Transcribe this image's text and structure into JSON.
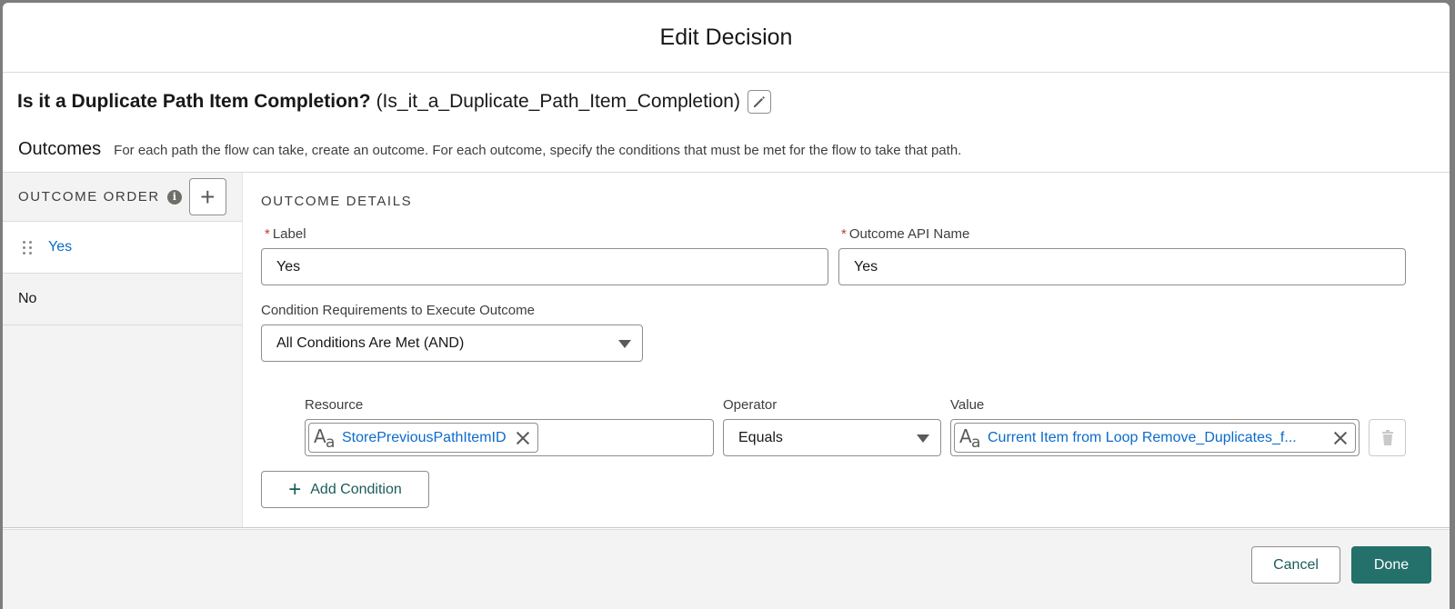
{
  "modal": {
    "title": "Edit Decision"
  },
  "decision": {
    "label": "Is it a Duplicate Path Item Completion?",
    "api_name": "(Is_it_a_Duplicate_Path_Item_Completion)"
  },
  "outcomes": {
    "title": "Outcomes",
    "description": "For each path the flow can take, create an outcome. For each outcome, specify the conditions that must be met for the flow to take that path."
  },
  "sidebar": {
    "header": "OUTCOME ORDER",
    "items": [
      {
        "label": "Yes",
        "active": true
      },
      {
        "label": "No",
        "active": false
      }
    ]
  },
  "details": {
    "section_title": "OUTCOME DETAILS",
    "label_field": {
      "label": "Label",
      "value": "Yes"
    },
    "api_field": {
      "label": "Outcome API Name",
      "value": "Yes"
    },
    "requirements": {
      "label": "Condition Requirements to Execute Outcome",
      "value": "All Conditions Are Met (AND)"
    },
    "condition": {
      "resource_label": "Resource",
      "resource_value": "StorePreviousPathItemID",
      "operator_label": "Operator",
      "operator_value": "Equals",
      "value_label": "Value",
      "value_value": "Current Item from Loop Remove_Duplicates_f..."
    },
    "add_condition_label": "Add Condition"
  },
  "footer": {
    "cancel_label": "Cancel",
    "done_label": "Done"
  },
  "colors": {
    "brand_button": "#24706b",
    "link": "#0b6bcb",
    "required": "#c23934"
  },
  "icons": {
    "edit": "pencil-icon",
    "info": "info-icon",
    "add": "plus-icon",
    "drag": "drag-handle-icon",
    "text_resource": "text-variable-icon",
    "clear": "close-icon",
    "delete": "trash-icon",
    "dropdown": "chevron-down-icon"
  }
}
